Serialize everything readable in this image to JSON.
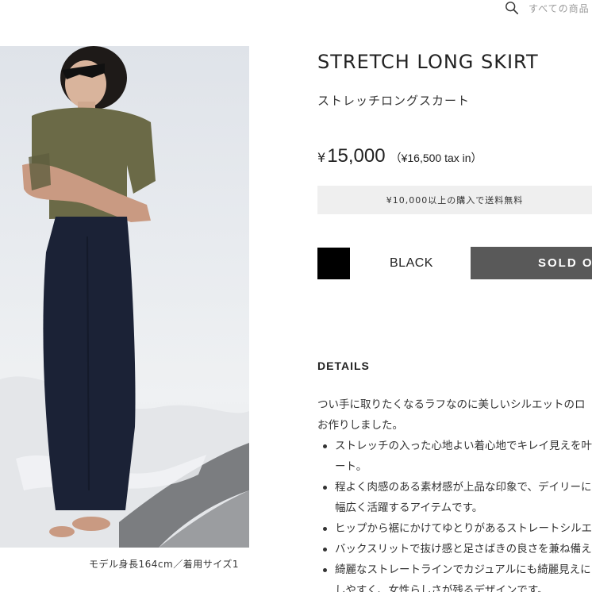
{
  "search": {
    "placeholder": "すべての商品",
    "icon": "search-icon"
  },
  "product": {
    "title": "STRETCH LONG SKIRT",
    "subtitle": "ストレッチロングスカート",
    "price": {
      "yen": "¥",
      "amount": "15,000",
      "tax": "（¥16,500 tax in）"
    },
    "shipping_note": "¥10,000以上の購入で送料無料",
    "color": {
      "name": "BLACK",
      "swatch": "#000000"
    },
    "status_button": "SOLD OU"
  },
  "photo": {
    "caption": "モデル身長164cm／着用サイズ1"
  },
  "details": {
    "heading": "DETAILS",
    "intro": [
      "つい手に取りたくなるラフなのに美しいシルエットのロ",
      "お作りしました。"
    ],
    "bullets": [
      [
        "ストレッチの入った心地よい着心地でキレイ見えを叶",
        "ート。"
      ],
      [
        "程よく肉感のある素材感が上品な印象で、デイリーに",
        "幅広く活躍するアイテムです。"
      ],
      [
        "ヒップから裾にかけてゆとりがあるストレートシルエ"
      ],
      [
        "バックスリットで抜け感と足さばきの良さを兼ね備え"
      ],
      [
        "綺麗なストレートラインでカジュアルにも綺麗見えに",
        "しやすく、女性らしさが残るデザインです。"
      ]
    ]
  }
}
